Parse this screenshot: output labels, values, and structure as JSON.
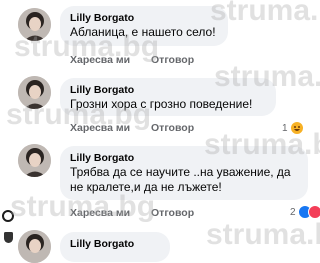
{
  "watermark": "struma.bg",
  "comments": [
    {
      "author": "Lilly Borgato",
      "text": "Абланица, е нашето село!",
      "like_label": "Харесва ми",
      "reply_label": "Отговор"
    },
    {
      "author": "Lilly Borgato",
      "text": "Грозни хора  с грозно поведение!",
      "like_label": "Харесва ми",
      "reply_label": "Отговор",
      "reaction_count": "1"
    },
    {
      "author": "Lilly Borgato",
      "text_line1": "Трябва да се научите ..на уважение, да",
      "text_line2": "не кралете,и да не лъжете!",
      "like_label": "Харесва ми",
      "reply_label": "Отговор",
      "reaction_count": "2"
    },
    {
      "author": "Lilly Borgato"
    }
  ],
  "colors": {
    "bubble": "#f0f2f5",
    "secondary_text": "#65676b",
    "like_blue": "#1877f2",
    "love_red": "#f33e58",
    "haha_yellow": "#f7b125"
  }
}
